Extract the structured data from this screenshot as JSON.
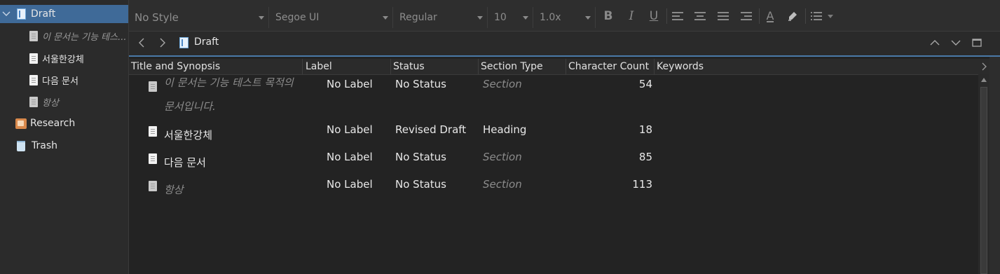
{
  "binder": {
    "items": [
      {
        "label": "Draft",
        "icon": "draft-folder-icon",
        "selected": true,
        "expanded": true
      },
      {
        "label": "이 문서는 기능 테스...",
        "icon": "document-icon",
        "italic": true
      },
      {
        "label": "서울한강체",
        "icon": "document-icon"
      },
      {
        "label": "다음 문서",
        "icon": "document-icon"
      },
      {
        "label": "항상",
        "icon": "document-icon",
        "italic": true
      },
      {
        "label": "Research",
        "icon": "research-folder-icon"
      },
      {
        "label": "Trash",
        "icon": "trash-icon"
      }
    ]
  },
  "toolbar": {
    "style": "No Style",
    "font": "Segoe UI",
    "weight": "Regular",
    "size": "10",
    "spacing": "1.0x",
    "bold": "B",
    "italic": "I",
    "underline": "U",
    "text_color": "A"
  },
  "editor": {
    "title": "Draft"
  },
  "outliner": {
    "columns": [
      "Title and Synopsis",
      "Label",
      "Status",
      "Section Type",
      "Character Count",
      "Keywords"
    ],
    "rows": [
      {
        "title": "이 문서는 기능 테스트 목적의 문서입니다.",
        "title_italic": true,
        "label": "No Label",
        "status": "No Status",
        "section_type": "Section",
        "section_type_default": true,
        "char_count": "54",
        "keywords": ""
      },
      {
        "title": "서울한강체",
        "title_italic": false,
        "label": "No Label",
        "status": "Revised Draft",
        "section_type": "Heading",
        "section_type_default": false,
        "char_count": "18",
        "keywords": ""
      },
      {
        "title": "다음 문서",
        "title_italic": false,
        "label": "No Label",
        "status": "No Status",
        "section_type": "Section",
        "section_type_default": true,
        "char_count": "85",
        "keywords": ""
      },
      {
        "title": "항상",
        "title_italic": true,
        "label": "No Label",
        "status": "No Status",
        "section_type": "Section",
        "section_type_default": true,
        "char_count": "113",
        "keywords": ""
      }
    ]
  },
  "colors": {
    "selection": "#3f6a98",
    "background": "#232323",
    "accent_line": "#4a79a8"
  }
}
